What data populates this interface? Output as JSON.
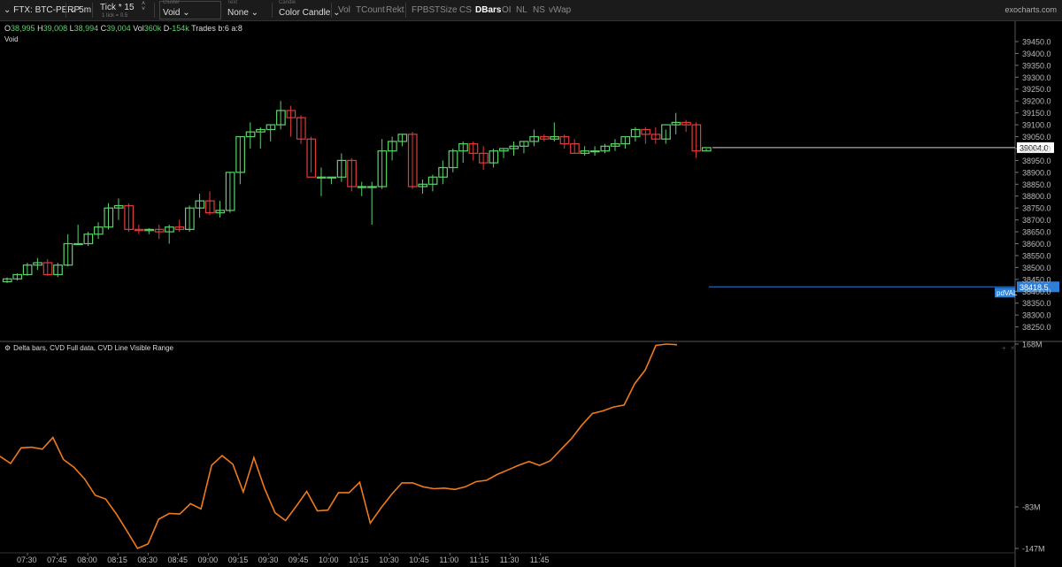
{
  "toolbar": {
    "symbol": "FTX: BTC-PERP",
    "timeframe": "5m",
    "tick": "Tick * 15",
    "tick_sub": "1 tick = 0.5",
    "cluster_caption": "Cluster",
    "cluster_value": "Void",
    "text_caption": "Text",
    "text_value": "None",
    "candle_caption": "Candle",
    "candle_value": "Color Candle",
    "buttons_a": [
      "Vol",
      "TCount",
      "Rekt"
    ],
    "buttons_b": [
      "FPBS",
      "TSize",
      "CS",
      "DBars",
      "OI",
      "NL",
      "NS",
      "vWap"
    ],
    "active_button": "DBars",
    "site": "exocharts.com"
  },
  "ohlc": {
    "o_label": "O",
    "o": "38,995",
    "h_label": "H",
    "h": "39,008",
    "l_label": "L",
    "l": "38,994",
    "c_label": "C",
    "c": "39,004",
    "vol_label": "Vol",
    "vol": "360k",
    "d_label": "D",
    "d": "-154k",
    "trades": "Trades b:6 a:8"
  },
  "void_label": "Void",
  "indicator_title": "Delta bars, CVD Full data, CVD Line Visible Range",
  "price_axis": {
    "ticks": [
      39450,
      39400,
      39350,
      39300,
      39250,
      39200,
      39150,
      39100,
      39050,
      39000,
      38950,
      38900,
      38850,
      38800,
      38750,
      38700,
      38650,
      38600,
      38550,
      38500,
      38450,
      38400,
      38350,
      38300,
      38250
    ],
    "range": [
      38215,
      39502
    ],
    "current_price": "39004.0",
    "current_price_value": 39004,
    "pdval_label": "pdVAL",
    "pdval_price": "38418.5",
    "pdval_value": 38418.5
  },
  "cvd_axis": {
    "labels": [
      "168M",
      "-83M",
      "-147M"
    ],
    "values": [
      168,
      -83,
      -147
    ],
    "range": [
      -147,
      168
    ]
  },
  "time_axis": {
    "labels": [
      "07:30",
      "07:45",
      "08:00",
      "08:15",
      "08:30",
      "08:45",
      "09:00",
      "09:15",
      "09:30",
      "09:45",
      "10:00",
      "10:15",
      "10:30",
      "10:45",
      "11:00",
      "11:15",
      "11:30",
      "11:45"
    ]
  },
  "colors": {
    "up": "#5bd36b",
    "down": "#e03c3c",
    "cvd_line": "#ee7a1c",
    "pdval": "#2b7fd8",
    "current_price_line": "#d0d0d0"
  },
  "chart_data": {
    "type": "candlestick",
    "candles": [
      [
        38440,
        38458,
        38435,
        38452
      ],
      [
        38452,
        38475,
        38445,
        38470
      ],
      [
        38470,
        38520,
        38465,
        38510
      ],
      [
        38510,
        38540,
        38490,
        38520
      ],
      [
        38520,
        38535,
        38465,
        38470
      ],
      [
        38470,
        38520,
        38460,
        38510
      ],
      [
        38510,
        38640,
        38505,
        38600
      ],
      [
        38600,
        38680,
        38600,
        38600
      ],
      [
        38600,
        38650,
        38590,
        38640
      ],
      [
        38640,
        38690,
        38620,
        38670
      ],
      [
        38670,
        38770,
        38660,
        38750
      ],
      [
        38750,
        38790,
        38700,
        38760
      ],
      [
        38760,
        38770,
        38650,
        38660
      ],
      [
        38660,
        38680,
        38640,
        38655
      ],
      [
        38655,
        38665,
        38640,
        38660
      ],
      [
        38660,
        38680,
        38620,
        38650
      ],
      [
        38650,
        38680,
        38600,
        38670
      ],
      [
        38670,
        38700,
        38650,
        38660
      ],
      [
        38660,
        38760,
        38650,
        38750
      ],
      [
        38750,
        38810,
        38710,
        38780
      ],
      [
        38780,
        38820,
        38720,
        38730
      ],
      [
        38730,
        38780,
        38710,
        38740
      ],
      [
        38740,
        38900,
        38730,
        38900
      ],
      [
        38900,
        39050,
        38850,
        39050
      ],
      [
        39050,
        39110,
        39000,
        39070
      ],
      [
        39070,
        39090,
        39000,
        39080
      ],
      [
        39080,
        39100,
        39030,
        39100
      ],
      [
        39100,
        39200,
        39080,
        39160
      ],
      [
        39160,
        39180,
        39050,
        39130
      ],
      [
        39130,
        39140,
        39020,
        39040
      ],
      [
        39040,
        39050,
        38900,
        38880
      ],
      [
        38880,
        38920,
        38800,
        38880
      ],
      [
        38880,
        38880,
        38850,
        38880
      ],
      [
        38880,
        38980,
        38860,
        38950
      ],
      [
        38950,
        38960,
        38820,
        38840
      ],
      [
        38840,
        38860,
        38800,
        38840
      ],
      [
        38840,
        38860,
        38680,
        38840
      ],
      [
        38840,
        39040,
        38830,
        38990
      ],
      [
        38990,
        39050,
        38950,
        39030
      ],
      [
        39030,
        39060,
        39010,
        39060
      ],
      [
        39060,
        39070,
        38830,
        38840
      ],
      [
        38840,
        38870,
        38810,
        38850
      ],
      [
        38850,
        38890,
        38820,
        38880
      ],
      [
        38880,
        38950,
        38850,
        38920
      ],
      [
        38920,
        39000,
        38900,
        38990
      ],
      [
        38990,
        39030,
        38940,
        39020
      ],
      [
        39020,
        39030,
        38950,
        38980
      ],
      [
        38980,
        39010,
        38910,
        38940
      ],
      [
        38940,
        39000,
        38920,
        38990
      ],
      [
        38990,
        39000,
        38960,
        39000
      ],
      [
        39000,
        39030,
        38970,
        39010
      ],
      [
        39010,
        39030,
        38980,
        39030
      ],
      [
        39030,
        39080,
        39010,
        39050
      ],
      [
        39050,
        39060,
        39030,
        39040
      ],
      [
        39040,
        39110,
        39030,
        39050
      ],
      [
        39050,
        39060,
        39000,
        39020
      ],
      [
        39020,
        39040,
        38980,
        38980
      ],
      [
        38980,
        39010,
        38970,
        38990
      ],
      [
        38990,
        39010,
        38970,
        38990
      ],
      [
        38990,
        39020,
        38980,
        39010
      ],
      [
        39010,
        39040,
        38990,
        39020
      ],
      [
        39020,
        39050,
        39000,
        39050
      ],
      [
        39050,
        39090,
        39030,
        39080
      ],
      [
        39080,
        39090,
        39020,
        39060
      ],
      [
        39060,
        39090,
        39020,
        39040
      ],
      [
        39040,
        39080,
        39020,
        39100
      ],
      [
        39100,
        39150,
        39060,
        39110
      ],
      [
        39110,
        39120,
        39070,
        39100
      ],
      [
        39100,
        39110,
        38960,
        38990
      ],
      [
        38990,
        39000,
        38990,
        39004
      ]
    ],
    "cvd": [
      -5,
      -16,
      8,
      9,
      6,
      24,
      -10,
      -22,
      -40,
      -65,
      -71,
      -94,
      -120,
      -147,
      -140,
      -102,
      -93,
      -94,
      -78,
      -86,
      -19,
      -4,
      -17,
      -60,
      -7,
      -54,
      -92,
      -104,
      -82,
      -59,
      -89,
      -88,
      -61,
      -61,
      -45,
      -108,
      -85,
      -64,
      -46,
      -46,
      -52,
      -55,
      -54,
      -56,
      -52,
      -44,
      -42,
      -33,
      -26,
      -19,
      -13,
      -19,
      -12,
      5,
      22,
      43,
      61,
      65,
      71,
      74,
      107,
      128,
      166,
      168,
      167
    ],
    "cvd_unit": "M"
  }
}
